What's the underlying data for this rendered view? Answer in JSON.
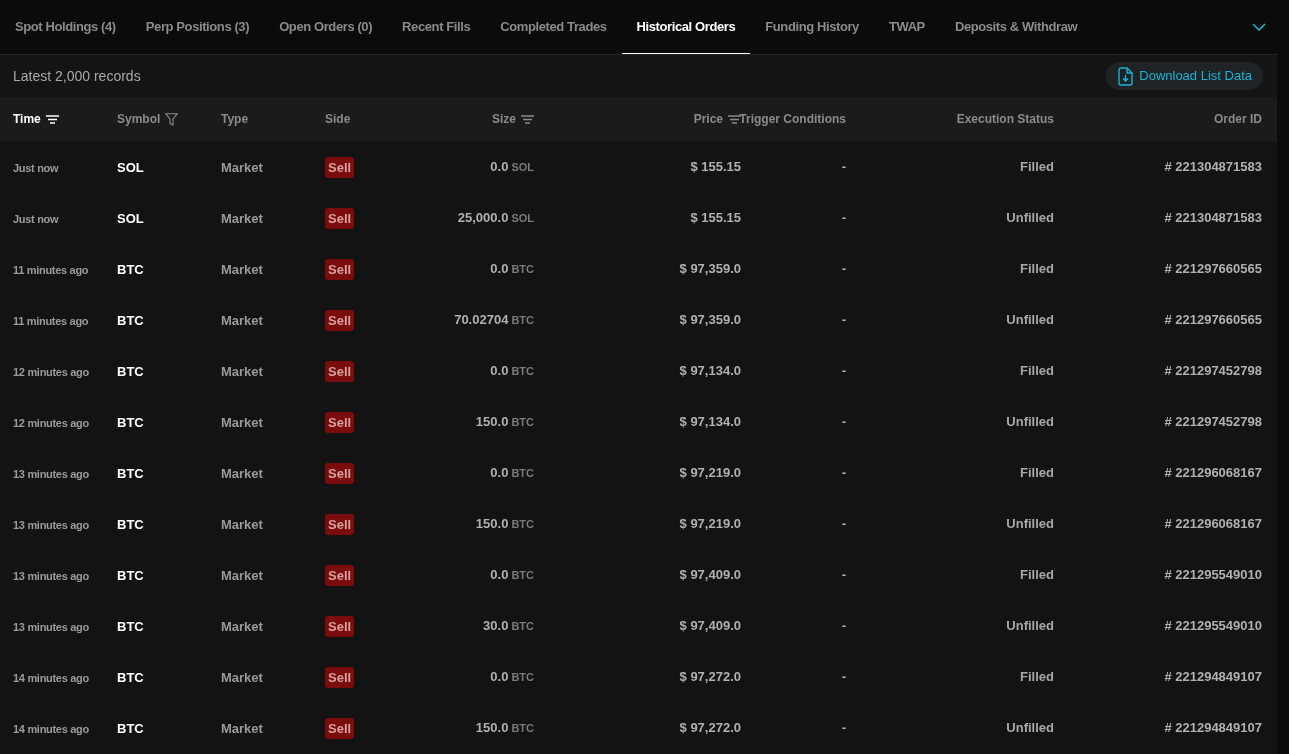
{
  "tabs": [
    {
      "label": "Spot Holdings (4)",
      "selected": false
    },
    {
      "label": "Perp Positions (3)",
      "selected": false
    },
    {
      "label": "Open Orders (0)",
      "selected": false
    },
    {
      "label": "Recent Fills",
      "selected": false
    },
    {
      "label": "Completed Trades",
      "selected": false
    },
    {
      "label": "Historical Orders",
      "selected": true
    },
    {
      "label": "Funding History",
      "selected": false
    },
    {
      "label": "TWAP",
      "selected": false
    },
    {
      "label": "Deposits & Withdraw",
      "selected": false
    }
  ],
  "record_count": "Latest 2,000 records",
  "download_button": "Download List Data",
  "columns": [
    {
      "label": "Time",
      "kind": "sort",
      "active": true
    },
    {
      "label": "Symbol",
      "kind": "filter",
      "active": false
    },
    {
      "label": "Type",
      "active": false
    },
    {
      "label": "Side",
      "active": false
    },
    {
      "label": "Size",
      "kind": "sort",
      "active": false
    },
    {
      "label": "Price",
      "kind": "sort",
      "active": false
    },
    {
      "label": "Trigger Conditions",
      "active": false
    },
    {
      "label": "Execution Status",
      "active": false
    },
    {
      "label": "Order ID",
      "active": false
    }
  ],
  "rows": [
    {
      "time": "Just now",
      "symbol": "SOL",
      "type": "Market",
      "side": "Sell",
      "size": "0.0",
      "unit": "SOL",
      "price": "$ 155.15",
      "trigger": "-",
      "status": "Filled",
      "order_id": "# 221304871583"
    },
    {
      "time": "Just now",
      "symbol": "SOL",
      "type": "Market",
      "side": "Sell",
      "size": "25,000.0",
      "unit": "SOL",
      "price": "$ 155.15",
      "trigger": "-",
      "status": "Unfilled",
      "order_id": "# 221304871583"
    },
    {
      "time": "11 minutes ago",
      "symbol": "BTC",
      "type": "Market",
      "side": "Sell",
      "size": "0.0",
      "unit": "BTC",
      "price": "$ 97,359.0",
      "trigger": "-",
      "status": "Filled",
      "order_id": "# 221297660565"
    },
    {
      "time": "11 minutes ago",
      "symbol": "BTC",
      "type": "Market",
      "side": "Sell",
      "size": "70.02704",
      "unit": "BTC",
      "price": "$ 97,359.0",
      "trigger": "-",
      "status": "Unfilled",
      "order_id": "# 221297660565"
    },
    {
      "time": "12 minutes ago",
      "symbol": "BTC",
      "type": "Market",
      "side": "Sell",
      "size": "0.0",
      "unit": "BTC",
      "price": "$ 97,134.0",
      "trigger": "-",
      "status": "Filled",
      "order_id": "# 221297452798"
    },
    {
      "time": "12 minutes ago",
      "symbol": "BTC",
      "type": "Market",
      "side": "Sell",
      "size": "150.0",
      "unit": "BTC",
      "price": "$ 97,134.0",
      "trigger": "-",
      "status": "Unfilled",
      "order_id": "# 221297452798"
    },
    {
      "time": "13 minutes ago",
      "symbol": "BTC",
      "type": "Market",
      "side": "Sell",
      "size": "0.0",
      "unit": "BTC",
      "price": "$ 97,219.0",
      "trigger": "-",
      "status": "Filled",
      "order_id": "# 221296068167"
    },
    {
      "time": "13 minutes ago",
      "symbol": "BTC",
      "type": "Market",
      "side": "Sell",
      "size": "150.0",
      "unit": "BTC",
      "price": "$ 97,219.0",
      "trigger": "-",
      "status": "Unfilled",
      "order_id": "# 221296068167"
    },
    {
      "time": "13 minutes ago",
      "symbol": "BTC",
      "type": "Market",
      "side": "Sell",
      "size": "0.0",
      "unit": "BTC",
      "price": "$ 97,409.0",
      "trigger": "-",
      "status": "Filled",
      "order_id": "# 221295549010"
    },
    {
      "time": "13 minutes ago",
      "symbol": "BTC",
      "type": "Market",
      "side": "Sell",
      "size": "30.0",
      "unit": "BTC",
      "price": "$ 97,409.0",
      "trigger": "-",
      "status": "Unfilled",
      "order_id": "# 221295549010"
    },
    {
      "time": "14 minutes ago",
      "symbol": "BTC",
      "type": "Market",
      "side": "Sell",
      "size": "0.0",
      "unit": "BTC",
      "price": "$ 97,272.0",
      "trigger": "-",
      "status": "Filled",
      "order_id": "# 221294849107"
    },
    {
      "time": "14 minutes ago",
      "symbol": "BTC",
      "type": "Market",
      "side": "Sell",
      "size": "150.0",
      "unit": "BTC",
      "price": "$ 97,272.0",
      "trigger": "-",
      "status": "Unfilled",
      "order_id": "# 221294849107"
    }
  ]
}
